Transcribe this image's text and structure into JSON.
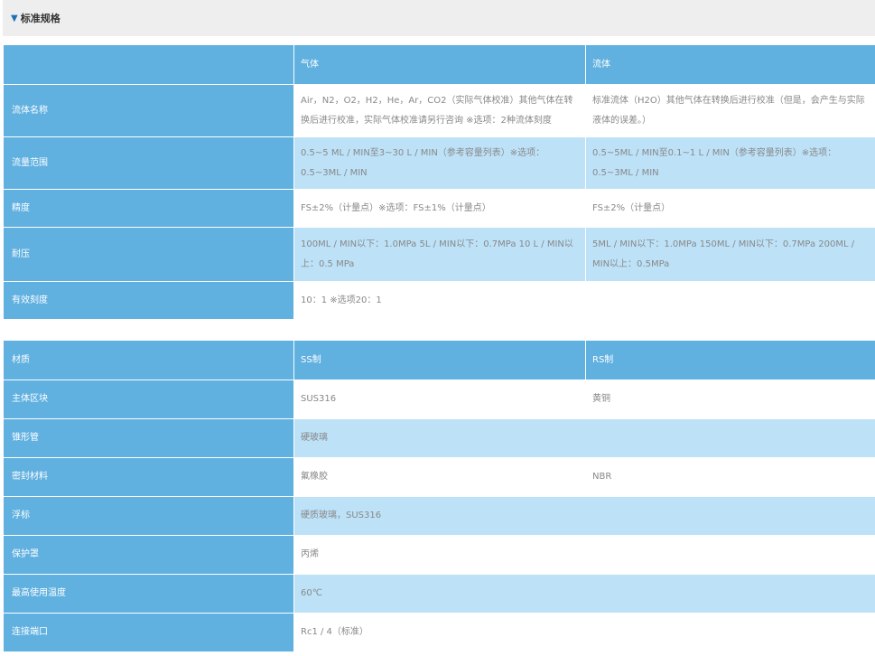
{
  "header": {
    "title": "标准规格"
  },
  "table1": {
    "columns": [
      "",
      "气体",
      "流体"
    ],
    "rows": [
      {
        "label": "流体名称",
        "gas": "Air，N2，O2，H2，He，Ar，CO2（实际气体校准）其他气体在转换后进行校准，实际气体校准请另行咨询 ※选项：2种流体刻度",
        "liquid": "标准流体（H2O）其他气体在转换后进行校准（但是，会产生与实际液体的误差。）"
      },
      {
        "label": "流量范围",
        "gas": "0.5~5 ML / MIN至3~30 L / MIN（参考容量列表）※选项：0.5~3ML / MIN",
        "liquid": "0.5~5ML / MIN至0.1~1 L / MIN（参考容量列表）※选项：0.5~3ML / MIN"
      },
      {
        "label": "精度",
        "gas": "FS±2%（计量点）※选项：FS±1%（计量点）",
        "liquid": "FS±2%（计量点）"
      },
      {
        "label": "耐压",
        "gas": "100ML / MIN以下：1.0MPa 5L / MIN以下：0.7MPa 10 L / MIN以上：0.5 MPa",
        "liquid": "5ML / MIN以下：1.0MPa 150ML / MIN以下：0.7MPa 200ML / MIN以上：0.5MPa"
      },
      {
        "label": "有效刻度",
        "value": "10：1 ※选项20：1"
      }
    ]
  },
  "table2": {
    "columns": [
      "材质",
      "SS制",
      "RS制"
    ],
    "rows": [
      {
        "label": "主体区块",
        "ss": "SUS316",
        "rs": "黄铜"
      },
      {
        "label": "锥形管",
        "value": "硬玻璃"
      },
      {
        "label": "密封材料",
        "ss": "氟橡胶",
        "rs": "NBR"
      },
      {
        "label": "浮标",
        "value": "硬质玻璃，SUS316"
      },
      {
        "label": "保护罩",
        "value": "丙烯"
      },
      {
        "label": "最高使用温度",
        "value": "60℃"
      },
      {
        "label": "连接端口",
        "value": "Rc1 / 4（标准）"
      }
    ]
  }
}
